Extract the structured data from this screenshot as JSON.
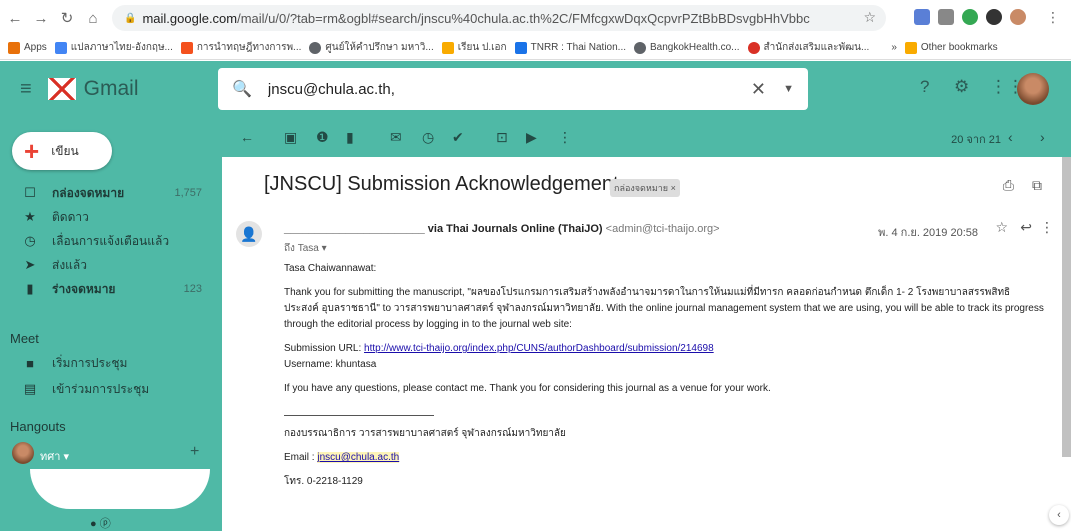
{
  "browser": {
    "url_host": "mail.google.com",
    "url_path": "/mail/u/0/?tab=rm&ogbl#search/jnscu%40chula.ac.th%2C/FMfcgxwDqxQcpvrPZtBbBDsvgbHhVbbc",
    "bookmarks": [
      {
        "label": "Apps",
        "color": "#e8710a"
      },
      {
        "label": "แปลภาษาไทย-อังกฤษ...",
        "color": "#4285f4"
      },
      {
        "label": "การนำทฤษฎีทางการพ...",
        "color": "#f4511e"
      },
      {
        "label": "ศูนย์ให้คำปรึกษา มหาวิ...",
        "color": "#5f6368"
      },
      {
        "label": "เรียน ป.เอก",
        "color": "#f9ab00"
      },
      {
        "label": "TNRR : Thai Nation...",
        "color": "#1a73e8"
      },
      {
        "label": "BangkokHealth.co...",
        "color": "#5f6368"
      },
      {
        "label": "สำนักส่งเสริมและพัฒน...",
        "color": "#d93025"
      }
    ],
    "more_bookmarks": "»",
    "other_bookmarks": "Other bookmarks"
  },
  "gmail": {
    "logo_text": "Gmail",
    "search_value": "jnscu@chula.ac.th,",
    "compose_label": "เขียน",
    "nav": [
      {
        "label": "กล่องจดหมาย",
        "count": "1,757",
        "icon": "inbox-icon",
        "bold": true
      },
      {
        "label": "ติดดาว",
        "count": "",
        "icon": "star-icon",
        "bold": false
      },
      {
        "label": "เลื่อนการแจ้งเตือนแล้ว",
        "count": "",
        "icon": "clock-icon",
        "bold": false
      },
      {
        "label": "ส่งแล้ว",
        "count": "",
        "icon": "send-icon",
        "bold": false
      },
      {
        "label": "ร่างจดหมาย",
        "count": "123",
        "icon": "draft-icon",
        "bold": true
      }
    ],
    "meet_title": "Meet",
    "meet_items": [
      "เริ่มการประชุม",
      "เข้าร่วมการประชุม"
    ],
    "hangouts_title": "Hangouts",
    "hangouts_user": "ทศา",
    "pager": "20 จาก 21"
  },
  "email": {
    "subject": "[JNSCU] Submission Acknowledgement",
    "label": "กล่องจดหมาย ×",
    "sender_blank": "_______________________",
    "sender_via": "via Thai Journals Online (ThaiJO)",
    "sender_email": "<admin@tci-thaijo.org>",
    "date": "พ. 4 ก.ย. 2019 20:58",
    "to": "ถึง Tasa ▾",
    "greeting": "Tasa Chaiwannawat:",
    "para1": "Thank you for submitting the manuscript, \"ผลของโปรแกรมการเสริมสร้างพลังอำนาจมารดาในการให้นมแม่ที่มีทารก คลอดก่อนกำหนด ตึกเด็ก 1- 2 โรงพยาบาลสรรพสิทธิประสงค์ อุบลราชธานี\" to วารสารพยาบาลศาสตร์ จุฬาลงกรณ์มหาวิทยาลัย. With the online journal management system that we are using, you will be able to track its progress through the editorial process by logging in to the journal web site:",
    "submission_label": "Submission URL: ",
    "submission_url": "http://www.tci-thaijo.org/index.php/CUNS/authorDashboard/submission/214698",
    "username_line": "Username: khuntasa",
    "para2": "If you have any questions, please contact me. Thank you for considering this journal as a venue for your work.",
    "sig_org": "กองบรรณาธิการ วารสารพยาบาลศาสตร์ จุฬาลงกรณ์มหาวิทยาลัย",
    "sig_email_label": "Email : ",
    "sig_email": "jnscu@chula.ac.th",
    "sig_phone": "โทร. 0-2218-1129"
  },
  "colors": {
    "accent": "#4fb9a6",
    "link": "#1a0dab",
    "compose_plus": "#ea4335"
  }
}
